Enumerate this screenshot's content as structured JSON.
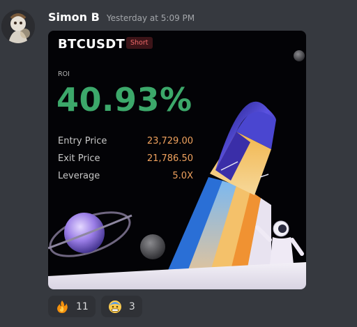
{
  "message": {
    "username": "Simon B",
    "timestamp": "Yesterday at 5:09 PM"
  },
  "card": {
    "pair": "BTCUSDT",
    "side": "Short",
    "roi_label": "ROI",
    "roi_value": "40.93%",
    "stats": [
      {
        "label": "Entry Price",
        "value": "23,729.00"
      },
      {
        "label": "Exit Price",
        "value": "21,786.50"
      },
      {
        "label": "Leverage",
        "value": "5.0X"
      }
    ],
    "colors": {
      "roi": "#3ca86a",
      "stat_value": "#f0a25e",
      "short_text": "#f06a6a",
      "short_bg": "#3c1418"
    }
  },
  "reactions": [
    {
      "icon": "fire-emoji-icon",
      "count": "11"
    },
    {
      "icon": "face-with-cold-sweat-emoji-icon",
      "count": "3"
    }
  ]
}
